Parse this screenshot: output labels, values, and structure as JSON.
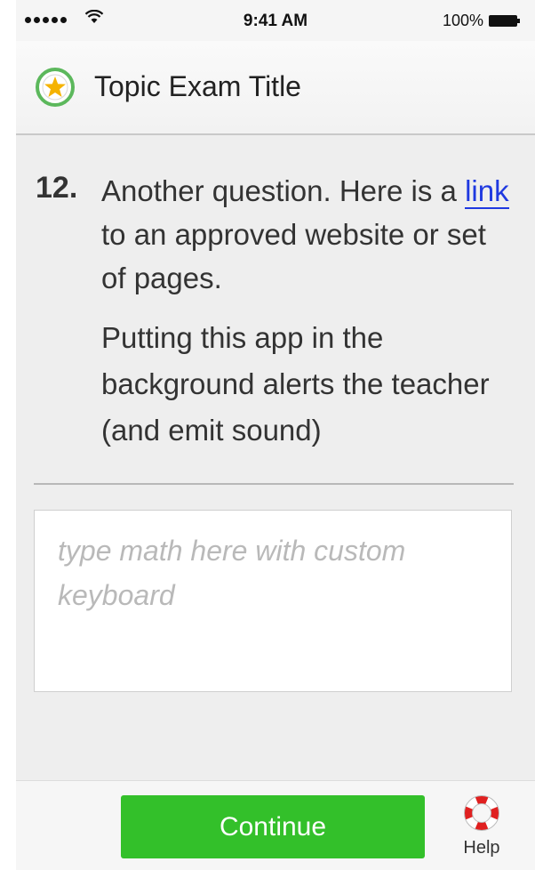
{
  "status_bar": {
    "time": "9:41 AM",
    "battery": "100%",
    "signal_icon": "signal-dots-icon",
    "wifi_icon": "wifi-icon",
    "battery_icon": "battery-icon"
  },
  "nav": {
    "title": "Topic Exam Title",
    "icon": "star-badge-icon"
  },
  "question": {
    "number": "12.",
    "text_before_link": "Another question. Here is a ",
    "link_text": "link",
    "text_after_link": " to an approved website or set of pages.",
    "note": "Putting this app in the background alerts the teacher (and emit sound)"
  },
  "answer": {
    "placeholder": "type math here with custom keyboard",
    "value": ""
  },
  "footer": {
    "continue_label": "Continue",
    "help_label": "Help",
    "help_icon": "lifebuoy-icon"
  },
  "colors": {
    "accent_green": "#33c02a",
    "link_blue": "#1f39e0",
    "star_gold": "#f5b300",
    "badge_green": "#5cb85c",
    "lifebuoy_red": "#e02020"
  }
}
